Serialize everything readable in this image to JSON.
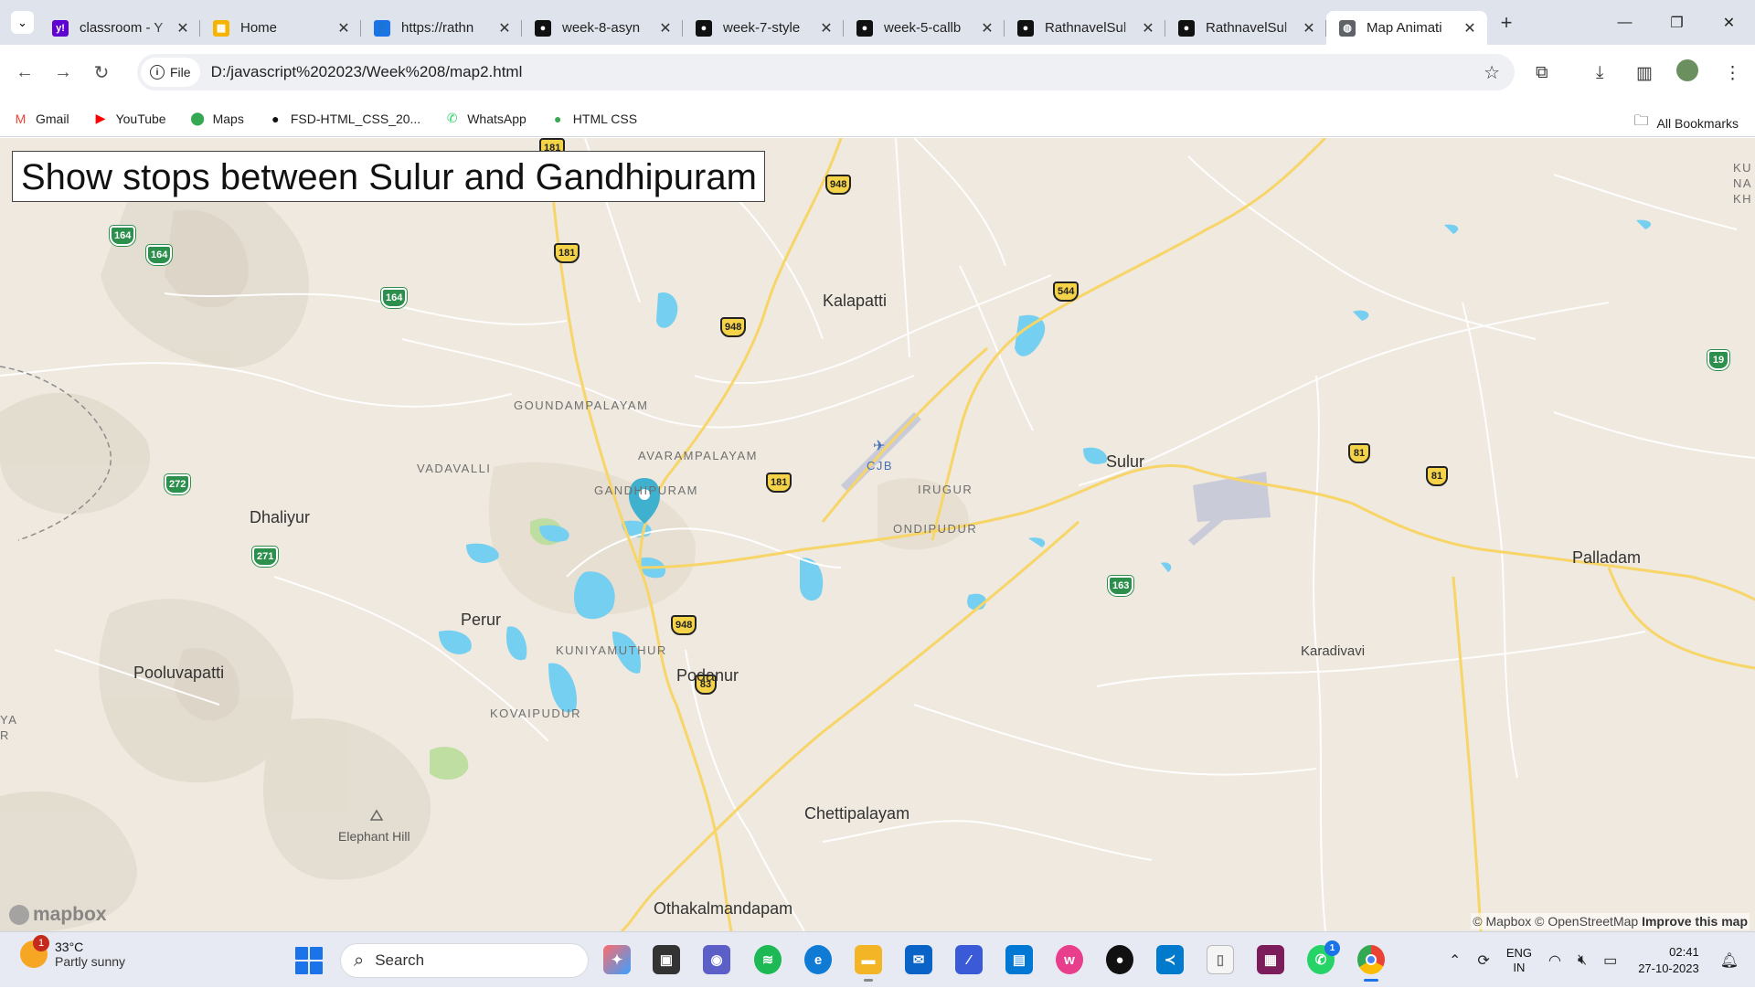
{
  "browser": {
    "tabs": [
      {
        "title": "classroom - Y",
        "favicon": "yahoo-icon",
        "color": "#5f01d1",
        "glyph": "y!"
      },
      {
        "title": "Home",
        "favicon": "home-slides-icon",
        "color": "#f4b400",
        "glyph": "▦"
      },
      {
        "title": "https://rathn",
        "favicon": "contacts-icon",
        "color": "#1a73e8",
        "glyph": "👤"
      },
      {
        "title": "week-8-asyn",
        "favicon": "github-icon",
        "color": "#111111",
        "glyph": "●"
      },
      {
        "title": "week-7-style",
        "favicon": "github-icon",
        "color": "#111111",
        "glyph": "●"
      },
      {
        "title": "week-5-callb",
        "favicon": "github-icon",
        "color": "#111111",
        "glyph": "●"
      },
      {
        "title": "RathnavelSul",
        "favicon": "github-icon",
        "color": "#111111",
        "glyph": "●"
      },
      {
        "title": "RathnavelSul",
        "favicon": "github-icon",
        "color": "#111111",
        "glyph": "●"
      },
      {
        "title": "Map Animati",
        "favicon": "globe-icon",
        "color": "#5f6368",
        "glyph": "◍",
        "active": true
      }
    ],
    "new_tab": "+",
    "address": {
      "chip_label": "File",
      "url": "D:/javascript%202023/Week%208/map2.html"
    },
    "bookmarks": [
      {
        "label": "Gmail",
        "icon": "gmail-icon",
        "color": "#ea4335",
        "glyph": "M"
      },
      {
        "label": "YouTube",
        "icon": "youtube-icon",
        "color": "#ff0000",
        "glyph": "▶"
      },
      {
        "label": "Maps",
        "icon": "maps-pin-icon",
        "color": "#34a853",
        "glyph": "⬤"
      },
      {
        "label": "FSD-HTML_CSS_20...",
        "icon": "github-icon",
        "color": "#111111",
        "glyph": "●"
      },
      {
        "label": "WhatsApp",
        "icon": "whatsapp-icon",
        "color": "#25d366",
        "glyph": "✆"
      },
      {
        "label": "HTML CSS",
        "icon": "github-icon",
        "color": "#34a853",
        "glyph": "●"
      }
    ],
    "all_bookmarks": "All Bookmarks"
  },
  "map": {
    "title": "Show stops between Sulur and Gandhipuram",
    "places": {
      "kalapatti": "Kalapatti",
      "goundampalayam": "GOUNDAMPALAYAM",
      "vadavalli": "VADAVALLI",
      "avarampalayam": "AVARAMPALAYAM",
      "gandhipuram": "GANDHIPURAM",
      "cjb": "CJB",
      "irugur": "IRUGUR",
      "ondipudur": "ONDIPUDUR",
      "sulur": "Sulur",
      "palladam": "Palladam",
      "dhaliyur": "Dhaliyur",
      "perur": "Perur",
      "kuniyamuthur": "KUNIYAMUTHUR",
      "podanur": "Podanur",
      "kovaipudur": "KOVAIPUDUR",
      "pooluvapatti": "Pooluvapatti",
      "karadivavi": "Karadivavi",
      "elephant_hill": "Elephant Hill",
      "chettipalayam": "Chettipalayam",
      "othakalmandapam": "Othakalmandapam",
      "edge_top_right": "KU NA KH",
      "edge_left": "YA R"
    },
    "shields": [
      "181",
      "948",
      "948",
      "181",
      "164",
      "164",
      "164",
      "544",
      "19",
      "81",
      "81",
      "181",
      "272",
      "271",
      "948",
      "83",
      "163"
    ],
    "logo": "mapbox",
    "attribution": {
      "mapbox": "© Mapbox",
      "osm": "© OpenStreetMap",
      "improve": "Improve this map"
    },
    "colors": {
      "land": "#efe9df",
      "water": "#75cff0",
      "highway": "#f5c842",
      "road": "#ffffff",
      "marker": "#3fb1ce"
    }
  },
  "taskbar": {
    "weather": {
      "temp": "33°C",
      "desc": "Partly sunny",
      "badge": "1"
    },
    "search": "Search",
    "language": {
      "line1": "ENG",
      "line2": "IN"
    },
    "clock": {
      "time": "02:41",
      "date": "27-10-2023"
    }
  }
}
